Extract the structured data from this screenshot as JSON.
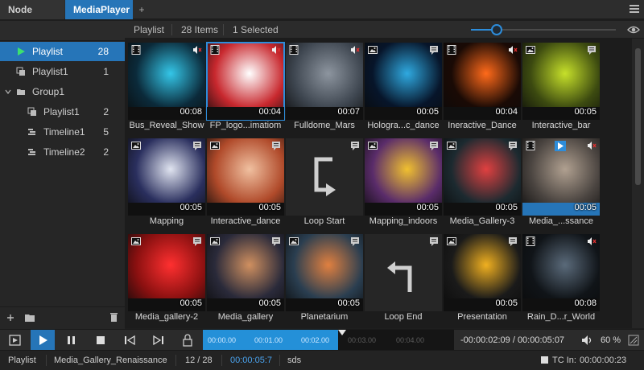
{
  "tabs": [
    {
      "label": "Node Graph",
      "active": false
    },
    {
      "label": "MediaPlayer",
      "active": true
    }
  ],
  "tab_add": "+",
  "sidebar": {
    "items": [
      {
        "label": "Playlist",
        "count": "28",
        "icon": "play-icon",
        "active": true
      },
      {
        "label": "Playlist1",
        "count": "1",
        "icon": "playlist-icon",
        "active": false
      },
      {
        "label": "Group1",
        "count": "",
        "icon": "folder-icon",
        "active": false
      },
      {
        "label": "Playlist1",
        "count": "2",
        "icon": "playlist-icon",
        "active": false
      },
      {
        "label": "Timeline1",
        "count": "5",
        "icon": "timeline-icon",
        "active": false
      },
      {
        "label": "Timeline2",
        "count": "2",
        "icon": "timeline-icon",
        "active": false
      }
    ]
  },
  "gridbar": {
    "playlist": "Playlist",
    "items": "28 Items",
    "selected": "1 Selected",
    "zoom_level": 0.18
  },
  "tiles": [
    {
      "name": "Bus_Reveal_Show",
      "duration": "00:08",
      "type": "video",
      "bg": "#0b2a3a",
      "accent": "#34c6e8"
    },
    {
      "name": "FP_logo...imatiom",
      "duration": "00:04",
      "type": "video",
      "bg": "#c8282e",
      "accent": "#ffffff",
      "selected": true
    },
    {
      "name": "Fulldome_Mars",
      "duration": "00:07",
      "type": "video",
      "bg": "#3e4650",
      "accent": "#8d959f"
    },
    {
      "name": "Hologra...c_dance",
      "duration": "00:05",
      "type": "image",
      "bg": "#07152a",
      "accent": "#2fa9e0"
    },
    {
      "name": "Ineractive_Dance",
      "duration": "00:04",
      "type": "video",
      "bg": "#1a0a05",
      "accent": "#ff6a1a"
    },
    {
      "name": "Interactive_bar",
      "duration": "00:05",
      "type": "image",
      "bg": "#3c4a10",
      "accent": "#c6e02a"
    },
    {
      "name": "Mapping",
      "duration": "00:05",
      "type": "image",
      "bg": "#2a2f5e",
      "accent": "#e0e4f0"
    },
    {
      "name": "Interactive_dance",
      "duration": "00:05",
      "type": "image",
      "bg": "#b04a2a",
      "accent": "#f0c0a0"
    },
    {
      "name": "Loop Start",
      "duration": "",
      "type": "loop-start",
      "bg": "#262626",
      "accent": "#cfcfcf"
    },
    {
      "name": "Mapping_indoors",
      "duration": "00:05",
      "type": "image",
      "bg": "#5a2c6a",
      "accent": "#f0c030"
    },
    {
      "name": "Media_Gallery-3",
      "duration": "00:05",
      "type": "image",
      "bg": "#1c2a30",
      "accent": "#e04040"
    },
    {
      "name": "Media_...ssance",
      "duration": "00:05",
      "type": "video",
      "bg": "#4a4440",
      "accent": "#b0a090",
      "marked": true
    },
    {
      "name": "Media_gallery-2",
      "duration": "00:05",
      "type": "image",
      "bg": "#8a1010",
      "accent": "#ff3030"
    },
    {
      "name": "Media_gallery",
      "duration": "00:05",
      "type": "image",
      "bg": "#2a2a3a",
      "accent": "#d09060"
    },
    {
      "name": "Planetarium",
      "duration": "00:05",
      "type": "image",
      "bg": "#2a3e50",
      "accent": "#e08040"
    },
    {
      "name": "Loop End",
      "duration": "",
      "type": "loop-end",
      "bg": "#262626",
      "accent": "#cfcfcf"
    },
    {
      "name": "Presentation",
      "duration": "00:05",
      "type": "image",
      "bg": "#1a1a1a",
      "accent": "#f0b020"
    },
    {
      "name": "Rain_D...r_World",
      "duration": "00:08",
      "type": "video",
      "bg": "#101418",
      "accent": "#5a6a7a"
    }
  ],
  "transport": {
    "markers": [
      "00:00.00",
      "00:01.00",
      "00:02.00",
      "00:03.00",
      "00:04.00"
    ],
    "played_markers": 3,
    "position": "-00:00:02:09 / 00:00:05:07",
    "volume": "60 %"
  },
  "statusbar": {
    "playlist": "Playlist",
    "media": "Media_Gallery_Renaissance",
    "index": "12 / 28",
    "duration": "00:00:05:7",
    "note": "sds",
    "tc_label": "TC In:",
    "tc_value": "00:00:00:23"
  },
  "colors": {
    "accent": "#2675b8",
    "highlight": "#2d8ddb"
  }
}
